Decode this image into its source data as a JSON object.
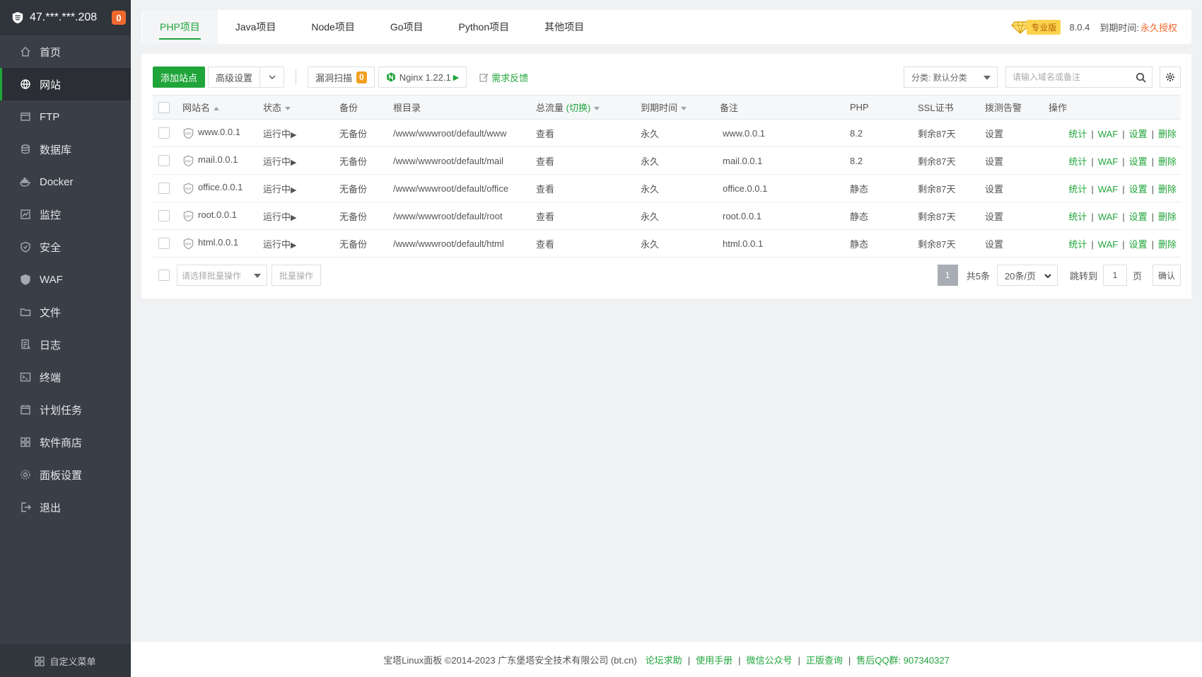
{
  "sidebar": {
    "ip": "47.***.***.208",
    "badge": "0",
    "items": [
      {
        "label": "首页",
        "icon": "home-icon"
      },
      {
        "label": "网站",
        "icon": "globe-icon",
        "active": true
      },
      {
        "label": "FTP",
        "icon": "ftp-icon"
      },
      {
        "label": "数据库",
        "icon": "database-icon"
      },
      {
        "label": "Docker",
        "icon": "docker-icon"
      },
      {
        "label": "监控",
        "icon": "monitor-icon"
      },
      {
        "label": "安全",
        "icon": "security-shield-icon"
      },
      {
        "label": "WAF",
        "icon": "waf-icon"
      },
      {
        "label": "文件",
        "icon": "folder-icon"
      },
      {
        "label": "日志",
        "icon": "log-icon"
      },
      {
        "label": "终端",
        "icon": "terminal-icon"
      },
      {
        "label": "计划任务",
        "icon": "calendar-icon"
      },
      {
        "label": "软件商店",
        "icon": "apps-icon"
      },
      {
        "label": "面板设置",
        "icon": "settings-icon"
      },
      {
        "label": "退出",
        "icon": "logout-icon"
      }
    ],
    "custom_menu": "自定义菜单"
  },
  "tabs": [
    "PHP项目",
    "Java项目",
    "Node项目",
    "Go项目",
    "Python项目",
    "其他项目"
  ],
  "top_right": {
    "edition": "专业版",
    "version": "8.0.4",
    "expire_label": "到期时间:",
    "expire_value": "永久授权"
  },
  "toolbar": {
    "add_site": "添加站点",
    "advanced": "高级设置",
    "vuln_scan": "漏洞扫描",
    "vuln_count": "0",
    "nginx": "Nginx 1.22.1",
    "feedback": "需求反馈",
    "category": "分类: 默认分类",
    "search_placeholder": "请输入域名或备注"
  },
  "table": {
    "headers": {
      "name": "网站名",
      "status": "状态",
      "backup": "备份",
      "root": "根目录",
      "traffic": "总流量",
      "traffic_switch": "(切换)",
      "expire": "到期时间",
      "remark": "备注",
      "php": "PHP",
      "ssl": "SSL证书",
      "probe": "拨测告警",
      "ops": "操作"
    },
    "rows": [
      {
        "name": "www.0.0.1",
        "status": "运行中",
        "backup": "无备份",
        "root": "/www/wwwroot/default/www",
        "traffic": "查看",
        "expire": "永久",
        "remark": "www.0.0.1",
        "php": "8.2",
        "ssl": "剩余87天",
        "probe": "设置"
      },
      {
        "name": "mail.0.0.1",
        "status": "运行中",
        "backup": "无备份",
        "root": "/www/wwwroot/default/mail",
        "traffic": "查看",
        "expire": "永久",
        "remark": "mail.0.0.1",
        "php": "8.2",
        "ssl": "剩余87天",
        "probe": "设置"
      },
      {
        "name": "office.0.0.1",
        "status": "运行中",
        "backup": "无备份",
        "root": "/www/wwwroot/default/office",
        "traffic": "查看",
        "expire": "永久",
        "remark": "office.0.0.1",
        "php": "静态",
        "ssl": "剩余87天",
        "probe": "设置"
      },
      {
        "name": "root.0.0.1",
        "status": "运行中",
        "backup": "无备份",
        "root": "/www/wwwroot/default/root",
        "traffic": "查看",
        "expire": "永久",
        "remark": "root.0.0.1",
        "php": "静态",
        "ssl": "剩余87天",
        "probe": "设置"
      },
      {
        "name": "html.0.0.1",
        "status": "运行中",
        "backup": "无备份",
        "root": "/www/wwwroot/default/html",
        "traffic": "查看",
        "expire": "永久",
        "remark": "html.0.0.1",
        "php": "静态",
        "ssl": "剩余87天",
        "probe": "设置"
      }
    ],
    "ops": [
      "统计",
      "WAF",
      "设置",
      "删除"
    ]
  },
  "batch": {
    "select_placeholder": "请选择批量操作",
    "button": "批量操作"
  },
  "pager": {
    "current": "1",
    "total": "共5条",
    "page_size": "20条/页",
    "jump_label": "跳转到",
    "jump_value": "1",
    "page_unit": "页",
    "confirm": "确认"
  },
  "footer": {
    "copyright": "宝塔Linux面板 ©2014-2023 广东堡塔安全技术有限公司 (bt.cn)",
    "links": [
      "论坛求助",
      "使用手册",
      "微信公众号",
      "正版查询",
      "售后QQ群: 907340327"
    ]
  },
  "colors": {
    "accent": "#20a53a",
    "warning": "#f0a020",
    "sidebar_bg": "#3a3f47",
    "orange": "#f0692e"
  }
}
